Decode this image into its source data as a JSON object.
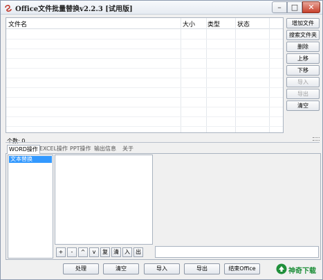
{
  "window": {
    "title": "Office文件批量替换v2.2.3 [试用版]",
    "minimize": "–",
    "maximize": "□",
    "close": "✕"
  },
  "file_table": {
    "columns": [
      "文件名",
      "大小",
      "类型",
      "状态"
    ],
    "rows": []
  },
  "side_buttons": [
    {
      "label": "增加文件",
      "enabled": true
    },
    {
      "label": "搜索文件夹",
      "enabled": true
    },
    {
      "label": "删除",
      "enabled": true
    },
    {
      "label": "上移",
      "enabled": true
    },
    {
      "label": "下移",
      "enabled": true
    },
    {
      "label": "导入",
      "enabled": false
    },
    {
      "label": "导出",
      "enabled": false
    },
    {
      "label": "清空",
      "enabled": true
    }
  ],
  "status": {
    "count_label": "个数: 0"
  },
  "tabs": [
    "WORD操作",
    "EXCEL操作",
    "PPT操作",
    "输出信息",
    "关于"
  ],
  "operations": [
    "文本替换"
  ],
  "rule_toolbar": [
    "+",
    "-",
    "^",
    "v",
    "复",
    "清",
    "入",
    "出"
  ],
  "bottom_buttons": [
    "处理",
    "清空",
    "导入",
    "导出",
    "结束Office"
  ],
  "brand": {
    "text": "神奇下载",
    "color": "#1f8f3a"
  },
  "colors": {
    "selection": "#3399ff",
    "close_button": "#c7402a"
  }
}
